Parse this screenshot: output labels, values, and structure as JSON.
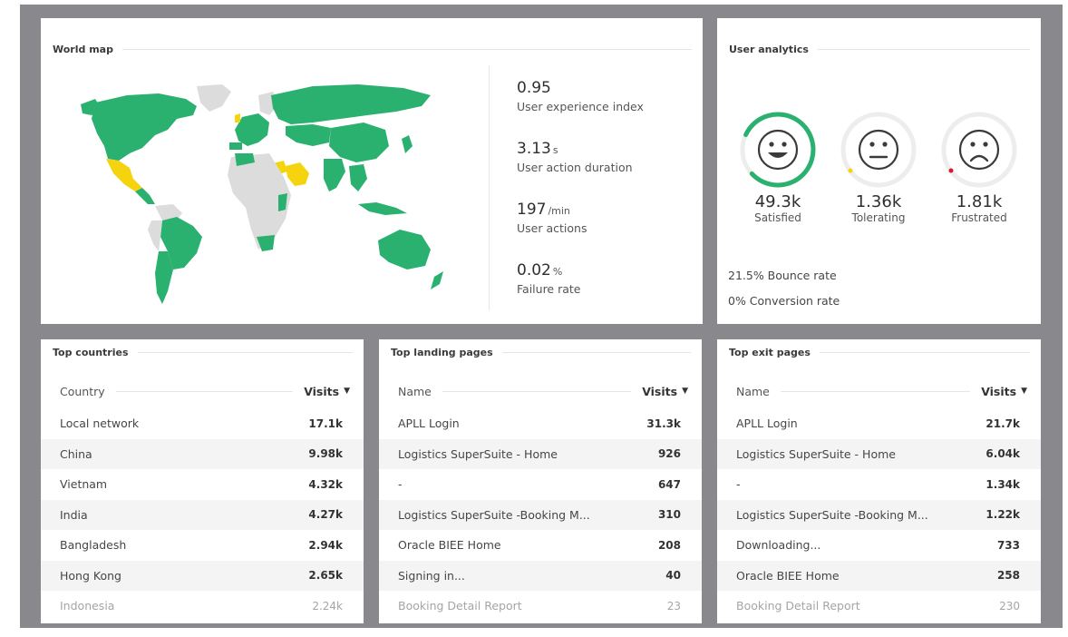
{
  "world": {
    "title": "World map",
    "metrics": [
      {
        "value": "0.95",
        "unit": "",
        "label": "User experience index"
      },
      {
        "value": "3.13",
        "unit": "s",
        "label": "User action duration"
      },
      {
        "value": "197",
        "unit": "/min",
        "label": "User actions"
      },
      {
        "value": "0.02",
        "unit": "%",
        "label": "Failure rate"
      }
    ],
    "colors": {
      "good": "#2ab06f",
      "warn": "#f5d30f",
      "nodata": "#dcdcdc"
    }
  },
  "user": {
    "title": "User analytics",
    "faces": [
      {
        "count": "49.3k",
        "label": "Satisfied",
        "icon": "satisfied-face-icon"
      },
      {
        "count": "1.36k",
        "label": "Tolerating",
        "icon": "tolerating-face-icon"
      },
      {
        "count": "1.81k",
        "label": "Frustrated",
        "icon": "frustrated-face-icon"
      }
    ],
    "bounce_rate": "21.5% Bounce rate",
    "conversion_rate": "0% Conversion rate"
  },
  "countries": {
    "title": "Top countries",
    "col_name": "Country",
    "col_visits": "Visits",
    "rows": [
      {
        "name": "Local network",
        "visits": "17.1k"
      },
      {
        "name": "China",
        "visits": "9.98k"
      },
      {
        "name": "Vietnam",
        "visits": "4.32k"
      },
      {
        "name": "India",
        "visits": "4.27k"
      },
      {
        "name": "Bangladesh",
        "visits": "2.94k"
      },
      {
        "name": "Hong Kong",
        "visits": "2.65k"
      },
      {
        "name": "Indonesia",
        "visits": "2.24k"
      }
    ]
  },
  "landing": {
    "title": "Top landing pages",
    "col_name": "Name",
    "col_visits": "Visits",
    "rows": [
      {
        "name": "APLL Login",
        "visits": "31.3k"
      },
      {
        "name": "Logistics SuperSuite - Home",
        "visits": "926"
      },
      {
        "name": "-",
        "visits": "647"
      },
      {
        "name": "Logistics SuperSuite -Booking M...",
        "visits": "310"
      },
      {
        "name": "Oracle BIEE Home",
        "visits": "208"
      },
      {
        "name": "Signing in...",
        "visits": "40"
      },
      {
        "name": "Booking Detail Report",
        "visits": "23"
      }
    ]
  },
  "exit": {
    "title": "Top exit pages",
    "col_name": "Name",
    "col_visits": "Visits",
    "rows": [
      {
        "name": "APLL Login",
        "visits": "21.7k"
      },
      {
        "name": "Logistics SuperSuite - Home",
        "visits": "6.04k"
      },
      {
        "name": "-",
        "visits": "1.34k"
      },
      {
        "name": "Logistics SuperSuite -Booking M...",
        "visits": "1.22k"
      },
      {
        "name": "Downloading...",
        "visits": "733"
      },
      {
        "name": "Oracle BIEE Home",
        "visits": "258"
      },
      {
        "name": "Booking Detail Report",
        "visits": "230"
      }
    ]
  }
}
